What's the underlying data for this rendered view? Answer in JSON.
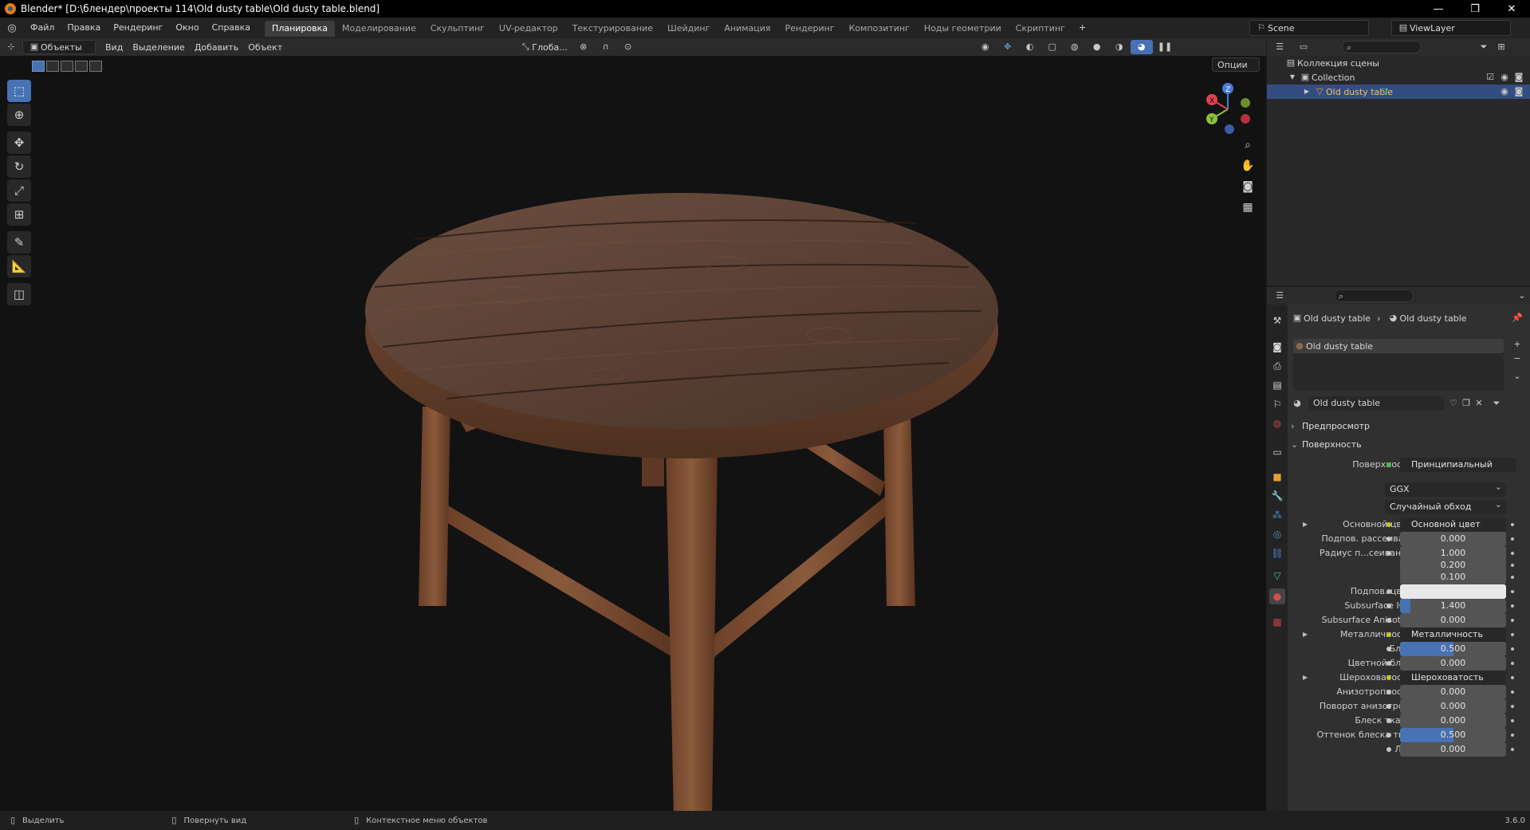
{
  "window": {
    "title": "Blender* [D:\\блендер\\проекты 114\\Old dusty table\\Old dusty table.blend]",
    "minimize": "—",
    "maximize": "❐",
    "close": "✕"
  },
  "menu": [
    "Файл",
    "Правка",
    "Рендеринг",
    "Окно",
    "Справка"
  ],
  "workspaces": [
    {
      "label": "Планировка",
      "active": true
    },
    {
      "label": "Моделирование"
    },
    {
      "label": "Скульптинг"
    },
    {
      "label": "UV-редактор"
    },
    {
      "label": "Текстурирование"
    },
    {
      "label": "Шейдинг"
    },
    {
      "label": "Анимация"
    },
    {
      "label": "Рендеринг"
    },
    {
      "label": "Композитинг"
    },
    {
      "label": "Ноды геометрии"
    },
    {
      "label": "Скриптинг"
    }
  ],
  "add_workspace": "+",
  "scene": {
    "name": "Scene",
    "view_layer": "ViewLayer"
  },
  "viewport_header": {
    "mode": "Объекты",
    "menus": [
      "Вид",
      "Выделение",
      "Добавить",
      "Объект"
    ],
    "transform_orientation": "Глоба...",
    "options": "Опции"
  },
  "gizmo": {
    "x": "X",
    "y": "Y",
    "z": "Z"
  },
  "outliner": {
    "scene_collection": "Коллекция сцены",
    "collection": "Collection",
    "object": "Old dusty table"
  },
  "properties": {
    "breadcrumb_object": "Old dusty table",
    "breadcrumb_material": "Old dusty table",
    "material_slot": "Old dusty table",
    "material_name": "Old dusty table",
    "section_preview": "Предпросмотр",
    "section_surface": "Поверхность",
    "surface_label": "Поверхность",
    "surface_value": "Принципиальный BSDF",
    "distribution": "GGX",
    "subsurface_method": "Случайный обход",
    "rows": [
      {
        "label": "Основной цвет",
        "value": "Основной цвет",
        "type": "link",
        "expand": true
      },
      {
        "label": "Подпов. рассеива...",
        "value": "0.000",
        "type": "num",
        "fill": 0
      },
      {
        "label": "Радиус п...сеивания",
        "value": "1.000",
        "type": "num",
        "fill": 0
      },
      {
        "label": "",
        "value": "0.200",
        "type": "num",
        "fill": 0
      },
      {
        "label": "",
        "value": "0.100",
        "type": "num",
        "fill": 0
      },
      {
        "label": "Подпов. цвет",
        "value": "",
        "type": "color",
        "color": "#e8e8e8"
      },
      {
        "label": "Subsurface IOR",
        "value": "1.400",
        "type": "num",
        "fill": 0.1
      },
      {
        "label": "Subsurface Anisotr...",
        "value": "0.000",
        "type": "num",
        "fill": 0
      },
      {
        "label": "Металличность",
        "value": "Металличность",
        "type": "link",
        "expand": true
      },
      {
        "label": "Блик",
        "value": "0.500",
        "type": "num",
        "fill": 0.5
      },
      {
        "label": "Цветной блик",
        "value": "0.000",
        "type": "num",
        "fill": 0
      },
      {
        "label": "Шероховатость",
        "value": "Шероховатость",
        "type": "link",
        "expand": true
      },
      {
        "label": "Анизотропность",
        "value": "0.000",
        "type": "num",
        "fill": 0
      },
      {
        "label": "Поворот анизотро...",
        "value": "0.000",
        "type": "num",
        "fill": 0
      },
      {
        "label": "Блеск ткани",
        "value": "0.000",
        "type": "num",
        "fill": 0
      },
      {
        "label": "Оттенок блеска тк...",
        "value": "0.500",
        "type": "num",
        "fill": 0.5
      },
      {
        "label": "Лак",
        "value": "0.000",
        "type": "num",
        "fill": 0
      }
    ]
  },
  "statusbar": {
    "select": "Выделить",
    "rotate": "Повернуть вид",
    "context": "Контекстное меню объектов",
    "version": "3.6.0"
  },
  "colors": {
    "accent": "#4772b3",
    "selected_row": "#334d80",
    "wood": "#6b4b3a"
  }
}
